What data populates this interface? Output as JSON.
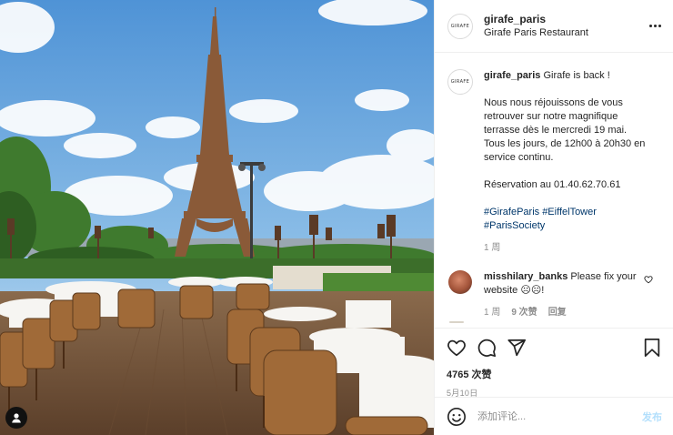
{
  "colors": {
    "text": "#262626",
    "muted": "#8e8e8e",
    "link": "#00376b",
    "post_disabled": "#b2dffc",
    "border": "#efefef"
  },
  "header": {
    "avatar_text": "GIRAFE",
    "username": "girafe_paris",
    "location": "Girafe Paris Restaurant",
    "more_icon": "more-dots-icon"
  },
  "caption": {
    "username": "girafe_paris",
    "lines": [
      "Girafe is back !",
      "",
      "Nous nous réjouissons de vous",
      "retrouver sur notre magnifique",
      "terrasse dès le mercredi 19 mai.",
      "Tous les jours, de 12h00 à 20h30 en",
      "service continu.",
      "",
      "Réservation au 01.40.62.70.61",
      "",
      "#GirafeParis #EiffelTower",
      "#ParisSociety"
    ],
    "time": "1 周"
  },
  "comment": {
    "username": "misshilary_banks",
    "text": "Please fix your website ☹☹!",
    "time": "1 周",
    "likes": "9 次赞",
    "reply": "回复"
  },
  "actions": {
    "like_icon": "heart-icon",
    "comment_icon": "comment-icon",
    "share_icon": "share-icon",
    "save_icon": "bookmark-icon"
  },
  "likes": "4765 次赞",
  "date": "5月10日",
  "add_comment": {
    "placeholder": "添加评论...",
    "post": "发布",
    "emoji_icon": "emoji-icon"
  }
}
